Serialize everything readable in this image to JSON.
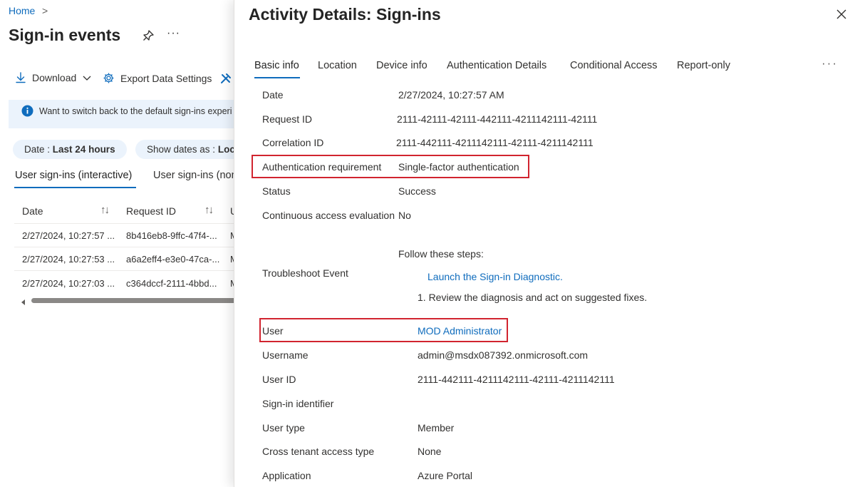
{
  "breadcrumb": {
    "home": "Home",
    "chevron": ">"
  },
  "page": {
    "title": "Sign-in events",
    "more": "···"
  },
  "toolbar": {
    "download": "Download",
    "export": "Export Data Settings"
  },
  "banner": {
    "text": "Want to switch back to the default sign-ins experi"
  },
  "filters": {
    "date_label": "Date :",
    "date_value": "Last 24 hours",
    "show_dates_label": "Show dates as :",
    "show_dates_value": "Loca"
  },
  "bg_tabs": {
    "interactive": "User sign-ins (interactive)",
    "noninteractive": "User sign-ins (non"
  },
  "table": {
    "columns": {
      "date": "Date",
      "request_id": "Request ID",
      "third": "U"
    },
    "sort_glyph": "↑↓",
    "rows": [
      {
        "date": "2/27/2024, 10:27:57 ...",
        "request_id": "8b416eb8-9ffc-47f4-...",
        "third": "M"
      },
      {
        "date": "2/27/2024, 10:27:53 ...",
        "request_id": "a6a2eff4-e3e0-47ca-...",
        "third": "M"
      },
      {
        "date": "2/27/2024, 10:27:03 ...",
        "request_id": "c364dccf-2111-4bbd...",
        "third": "M"
      }
    ]
  },
  "panel": {
    "title": "Activity Details: Sign-ins",
    "tabs": [
      "Basic info",
      "Location",
      "Device info",
      "Authentication Details",
      "Conditional Access",
      "Report-only"
    ],
    "tabs_more": "···",
    "fields": {
      "date": {
        "label": "Date",
        "value": "2/27/2024, 10:27:57 AM"
      },
      "request_id": {
        "label": "Request ID",
        "value": "2111-42111-42111-442111-4211142111-42111"
      },
      "correlation_id": {
        "label": "Correlation ID",
        "value": "2111-442111-4211142111-42111-4211142111"
      },
      "auth_requirement": {
        "label": "Authentication requirement",
        "value": "Single-factor authentication"
      },
      "status": {
        "label": "Status",
        "value": "Success"
      },
      "cae": {
        "label": "Continuous access evaluation",
        "value": "No"
      },
      "troubleshoot": {
        "label": "Troubleshoot Event",
        "intro": "Follow these steps:",
        "link": "Launch the Sign-in Diagnostic.",
        "step": "1. Review the diagnosis and act on suggested fixes."
      },
      "user": {
        "label": "User",
        "value": "MOD Administrator"
      },
      "username": {
        "label": "Username",
        "value": "admin@msdx087392.onmicrosoft.com"
      },
      "user_id": {
        "label": "User ID",
        "value": "2111-442111-4211142111-42111-4211142111"
      },
      "signin_identifier": {
        "label": "Sign-in identifier",
        "value": ""
      },
      "user_type": {
        "label": "User type",
        "value": "Member"
      },
      "cross_tenant": {
        "label": "Cross tenant access type",
        "value": "None"
      },
      "application": {
        "label": "Application",
        "value": "Azure Portal"
      }
    }
  },
  "colors": {
    "accent": "#0f6cbd",
    "highlight": "#d1242f",
    "banner": "#ebf3fc"
  }
}
